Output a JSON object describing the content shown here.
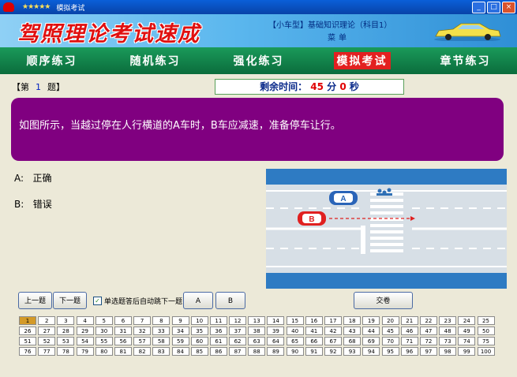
{
  "window": {
    "stars": "★★★★★",
    "title": "模拟考试",
    "btn_min": "_",
    "btn_max": "□",
    "btn_close": "×"
  },
  "banner": {
    "app_title": "驾照理论考试速成",
    "subject": "【小车型】基础知识理论（科目1）",
    "menu": "菜单"
  },
  "nav": {
    "items": [
      {
        "label": "顺序练习"
      },
      {
        "label": "随机练习"
      },
      {
        "label": "强化练习"
      },
      {
        "label": "模拟考试"
      },
      {
        "label": "章节练习"
      }
    ]
  },
  "question": {
    "prefix": "【第",
    "number": "1",
    "suffix": "题】",
    "text": "如图所示，当越过停在人行横道的A车时，B车应减速，准备停车让行。"
  },
  "timer": {
    "label": "剩余时间：",
    "minutes": "45",
    "min_unit": "分",
    "seconds": "0",
    "sec_unit": "秒"
  },
  "options": [
    {
      "key": "A:",
      "text": "正确"
    },
    {
      "key": "B:",
      "text": "错误"
    }
  ],
  "scene": {
    "car_a": "A",
    "car_b": "B"
  },
  "controls": {
    "prev": "上一题",
    "next": "下一题",
    "auto_next": "单选题答后自动跳下一题",
    "ans_a": "A",
    "ans_b": "B",
    "submit": "交卷"
  },
  "grid": {
    "current": "1",
    "total": "100"
  },
  "colors": {
    "nav_bg": "#0b6c3c",
    "nav_active": "#e32020",
    "question_bg": "#800080",
    "current_cell": "#d49a28"
  }
}
